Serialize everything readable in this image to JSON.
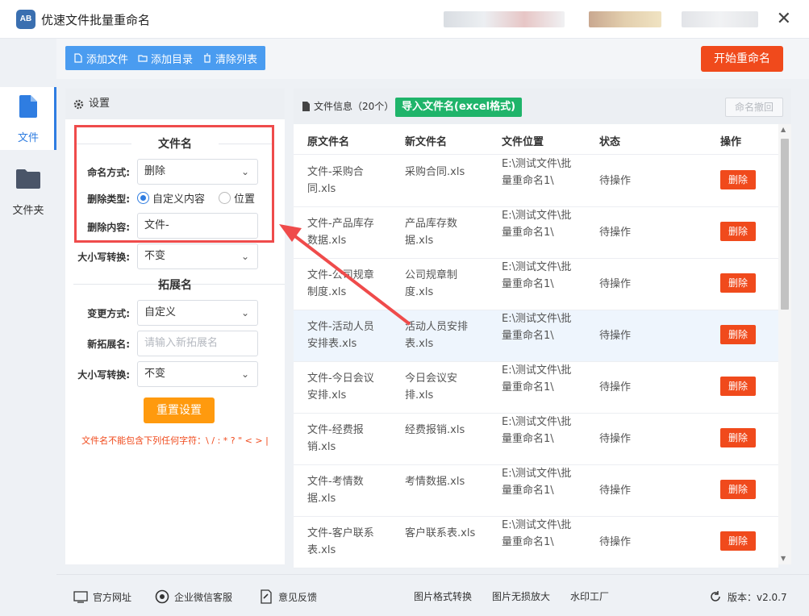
{
  "app": {
    "title": "优速文件批量重命名",
    "logo_text": "AB",
    "close_glyph": "✕"
  },
  "toolbar": {
    "add_file": "添加文件",
    "add_dir": "添加目录",
    "clear_list": "清除列表",
    "start": "开始重命名"
  },
  "sidebar": {
    "items": [
      {
        "label": "文件",
        "icon": "file-icon",
        "active": true
      },
      {
        "label": "文件夹",
        "icon": "folder-icon",
        "active": false
      }
    ]
  },
  "settings": {
    "header": "设置",
    "filename_section": "文件名",
    "naming_mode_label": "命名方式:",
    "naming_mode_value": "删除",
    "delete_type_label": "删除类型:",
    "delete_type_options": [
      "自定义内容",
      "位置"
    ],
    "delete_type_selected": "自定义内容",
    "delete_content_label": "删除内容:",
    "delete_content_value": "文件-",
    "case_label": "大小写转换:",
    "case_value": "不变",
    "ext_section": "拓展名",
    "change_mode_label": "变更方式:",
    "change_mode_value": "自定义",
    "new_ext_label": "新拓展名:",
    "new_ext_placeholder": "请输入新拓展名",
    "ext_case_label": "大小写转换:",
    "ext_case_value": "不变",
    "reset": "重置设置",
    "warning": "文件名不能包含下列任何字符：\\ / : * ? \" < > |"
  },
  "files": {
    "info": "文件信息（20个）",
    "import": "导入文件名(excel格式)",
    "undo": "命名撤回",
    "columns": [
      "原文件名",
      "新文件名",
      "文件位置",
      "状态",
      "操作"
    ],
    "rows": [
      {
        "orig": "文件-采购合同.xls",
        "new": "采购合同.xls",
        "path": "E:\\测试文件\\批量重命名1\\",
        "status": "待操作",
        "action": "删除"
      },
      {
        "orig": "文件-产品库存数据.xls",
        "new": "产品库存数据.xls",
        "path": "E:\\测试文件\\批量重命名1\\",
        "status": "待操作",
        "action": "删除"
      },
      {
        "orig": "文件-公司规章制度.xls",
        "new": "公司规章制度.xls",
        "path": "E:\\测试文件\\批量重命名1\\",
        "status": "待操作",
        "action": "删除"
      },
      {
        "orig": "文件-活动人员安排表.xls",
        "new": "活动人员安排表.xls",
        "path": "E:\\测试文件\\批量重命名1\\",
        "status": "待操作",
        "action": "删除"
      },
      {
        "orig": "文件-今日会议安排.xls",
        "new": "今日会议安排.xls",
        "path": "E:\\测试文件\\批量重命名1\\",
        "status": "待操作",
        "action": "删除"
      },
      {
        "orig": "文件-经费报销.xls",
        "new": "经费报销.xls",
        "path": "E:\\测试文件\\批量重命名1\\",
        "status": "待操作",
        "action": "删除"
      },
      {
        "orig": "文件-考情数据.xls",
        "new": "考情数据.xls",
        "path": "E:\\测试文件\\批量重命名1\\",
        "status": "待操作",
        "action": "删除"
      },
      {
        "orig": "文件-客户联系表.xls",
        "new": "客户联系表.xls",
        "path": "E:\\测试文件\\批量重命名1\\",
        "status": "待操作",
        "action": "删除"
      }
    ]
  },
  "footer": {
    "website": "官方网址",
    "wechat": "企业微信客服",
    "feedback": "意见反馈",
    "img_convert": "图片格式转换",
    "img_enlarge": "图片无损放大",
    "watermark": "水印工厂",
    "version": "版本：v2.0.7"
  },
  "colors": {
    "primary": "#4a9cf0",
    "danger": "#f04a1c",
    "success": "#1fb46a",
    "warning": "#ff9a0e",
    "highlight": "#ef4b4b"
  }
}
